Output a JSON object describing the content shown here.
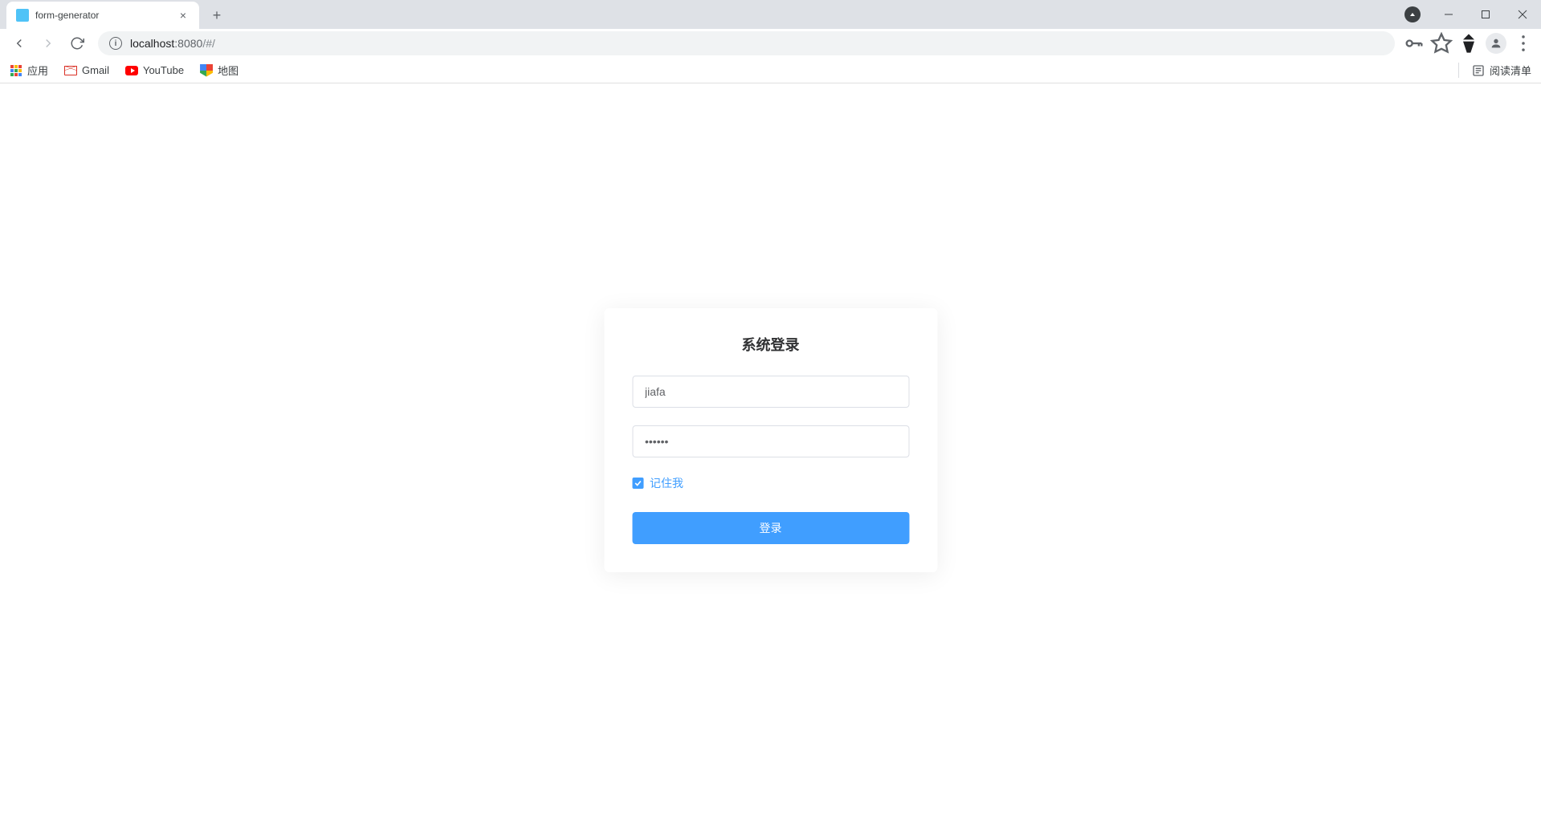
{
  "browser": {
    "tab_title": "form-generator",
    "url_host_prefix": "localhost",
    "url_host_suffix": ":8080",
    "url_path": "/#/"
  },
  "bookmarks": {
    "apps": "应用",
    "gmail": "Gmail",
    "youtube": "YouTube",
    "maps": "地图",
    "reading_list": "阅读清单"
  },
  "login": {
    "title": "系统登录",
    "username_value": "jiafa",
    "password_value": "••••••",
    "remember_label": "记住我",
    "remember_checked": true,
    "submit_label": "登录"
  }
}
